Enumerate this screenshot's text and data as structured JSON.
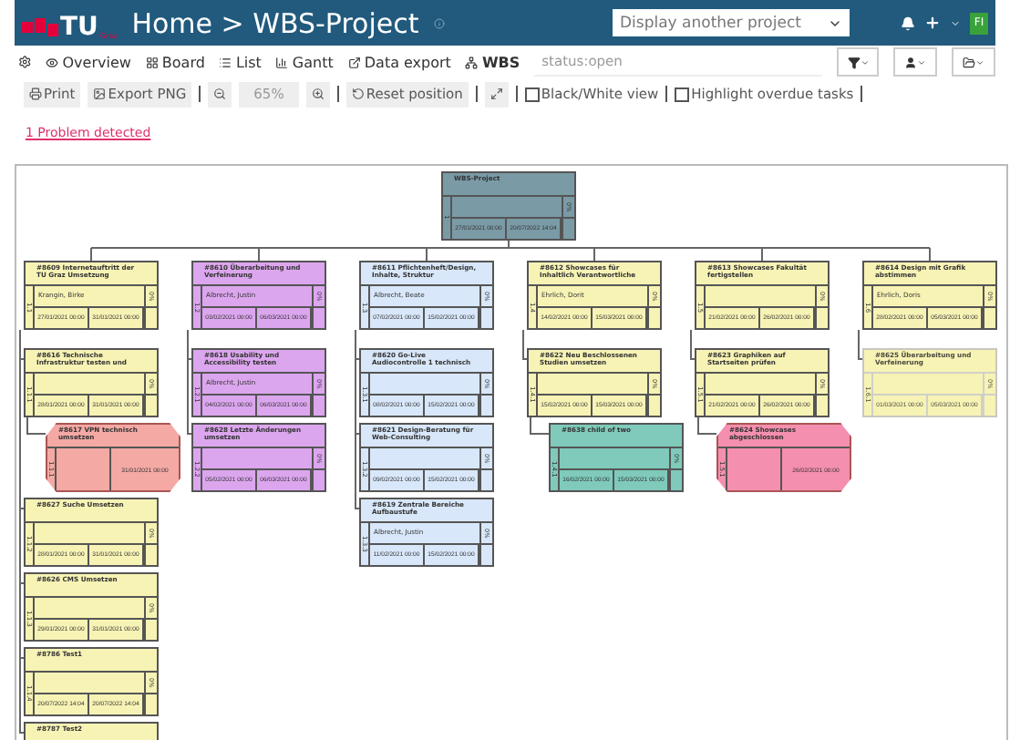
{
  "header": {
    "logo": "TU",
    "logo_sub": "Graz",
    "breadcrumb": "Home > WBS-Project",
    "project_select": {
      "value": "Display another project"
    },
    "avatar": "FI"
  },
  "nav": {
    "items": [
      {
        "label": "Overview",
        "selected": false
      },
      {
        "label": "Board",
        "selected": false
      },
      {
        "label": "List",
        "selected": false
      },
      {
        "label": "Gantt",
        "selected": false
      },
      {
        "label": "Data export",
        "selected": false
      },
      {
        "label": "WBS",
        "selected": true
      }
    ],
    "search": {
      "value": "status:open"
    }
  },
  "toolbar": {
    "print": "Print",
    "export": "Export PNG",
    "zoom": "65%",
    "reset": "Reset position",
    "checkboxes": [
      {
        "label": "Black/White view",
        "checked": false
      },
      {
        "label": "Highlight overdue tasks",
        "checked": false
      }
    ]
  },
  "problem_link": "1 Problem detected",
  "wbs": {
    "title": "WBS-Project",
    "kind": "task",
    "color": "#7a9aa6",
    "faded": false,
    "wbs": "1",
    "start": "27/01/2021 00:00",
    "end": "20/07/2022 14:04",
    "progress": "0%",
    "children": [
      {
        "title": "#8609 Internetauftritt der TU Graz Umsetzung",
        "kind": "task",
        "color": "#f7f3b5",
        "faded": false,
        "wbs": "1.1",
        "assignee": "Krangin, Birke",
        "start": "27/01/2021 00:00",
        "end": "31/01/2021 00:00",
        "progress": "0%",
        "children": [
          {
            "title": "#8616 Technische Infrastruktur testen und",
            "kind": "task",
            "color": "#f7f3b5",
            "faded": false,
            "wbs": "1.1.1",
            "start": "28/01/2021 00:00",
            "end": "31/01/2021 00:00",
            "progress": "0%",
            "children": [
              {
                "title": "#8617 VPN technisch umsetzen",
                "kind": "milestone",
                "color": "#f4a9a4",
                "faded": false,
                "wbs": "1.1.1",
                "end": "31/01/2021 00:00"
              }
            ]
          },
          {
            "title": "#8627 Suche Umsetzen",
            "kind": "task",
            "color": "#f7f3b5",
            "faded": false,
            "wbs": "1.1.2",
            "start": "28/01/2021 00:00",
            "end": "31/01/2021 00:00",
            "progress": "0%"
          },
          {
            "title": "#8626 CMS Umsetzen",
            "kind": "task",
            "color": "#f7f3b5",
            "faded": false,
            "wbs": "1.1.3",
            "start": "29/01/2021 00:00",
            "end": "31/01/2021 00:00",
            "progress": "0%"
          },
          {
            "title": "#8786 Test1",
            "kind": "task",
            "color": "#f7f3b5",
            "faded": false,
            "wbs": "1.1.4",
            "start": "20/07/2022 14:04",
            "end": "20/07/2022 14:04",
            "progress": "0%"
          },
          {
            "title": "#8787 Test2",
            "kind": "task",
            "color": "#f7f3b5",
            "faded": false
          }
        ]
      },
      {
        "title": "#8610 Überarbeitung und Verfeinerung",
        "kind": "task",
        "color": "#dca6ee",
        "faded": false,
        "wbs": "1.2",
        "assignee": "Albrecht, Justin",
        "start": "03/02/2021 00:00",
        "end": "06/03/2021 00:00",
        "progress": "0%",
        "children": [
          {
            "title": "#8618 Usability und Accessibility testen",
            "kind": "task",
            "color": "#dca6ee",
            "faded": false,
            "wbs": "1.2.1",
            "assignee": "Albrecht, Justin",
            "start": "04/02/2021 00:00",
            "end": "06/03/2021 00:00",
            "progress": "0%"
          },
          {
            "title": "#8628 Letzte Änderungen umsetzen",
            "kind": "task",
            "color": "#dca6ee",
            "faded": false,
            "wbs": "1.2.2",
            "start": "05/02/2021 00:00",
            "end": "06/03/2021 00:00",
            "progress": "0%"
          }
        ]
      },
      {
        "title": "#8611 Pflichtenheft/Design, Inhalte, Struktur",
        "kind": "task",
        "color": "#d8e7f9",
        "faded": false,
        "wbs": "1.3",
        "assignee": "Albrecht, Beate",
        "start": "07/02/2021 00:00",
        "end": "15/02/2021 00:00",
        "progress": "0%",
        "children": [
          {
            "title": "#8620 Go-Live Audiocontrolle 1 technisch",
            "kind": "task",
            "color": "#d8e7f9",
            "faded": false,
            "wbs": "1.3.1",
            "start": "08/02/2021 00:00",
            "end": "15/02/2021 00:00",
            "progress": "0%"
          },
          {
            "title": "#8621 Design-Beratung für Web-Consulting",
            "kind": "task",
            "color": "#d8e7f9",
            "faded": false,
            "wbs": "1.3.2",
            "start": "09/02/2021 00:00",
            "end": "15/02/2021 00:00",
            "progress": "0%"
          },
          {
            "title": "#8619 Zentrale Bereiche Aufbaustufe",
            "kind": "task",
            "color": "#d8e7f9",
            "faded": false,
            "wbs": "1.3.3",
            "assignee": "Albrecht, Justin",
            "start": "11/02/2021 00:00",
            "end": "15/02/2021 00:00",
            "progress": "0%"
          }
        ]
      },
      {
        "title": "#8612 Showcases für Inhaltlich Verantwortliche",
        "kind": "task",
        "color": "#f7f3b5",
        "faded": false,
        "wbs": "1.4",
        "assignee": "Ehrlich, Dorit",
        "start": "14/02/2021 00:00",
        "end": "15/03/2021 00:00",
        "progress": "0%",
        "children": [
          {
            "title": "#8622 Neu Beschlossenen Studien umsetzen",
            "kind": "task",
            "color": "#f7f3b5",
            "faded": false,
            "wbs": "1.4.1",
            "start": "15/02/2021 00:00",
            "end": "15/03/2021 00:00",
            "progress": "0%",
            "children": [
              {
                "title": "#8638 child of two",
                "kind": "task",
                "color": "#7fcabb",
                "faded": false,
                "wbs": "1.4.1",
                "start": "16/02/2021 00:00",
                "end": "15/03/2021 00:00",
                "progress": "0%"
              }
            ]
          }
        ]
      },
      {
        "title": "#8613 Showcases Fakultät fertigstellen",
        "kind": "task",
        "color": "#f7f3b5",
        "faded": false,
        "wbs": "1.5",
        "start": "21/02/2021 00:00",
        "end": "26/02/2021 00:00",
        "progress": "0%",
        "children": [
          {
            "title": "#8623 Graphiken auf Startseiten prüfen",
            "kind": "task",
            "color": "#f7f3b5",
            "faded": false,
            "wbs": "1.5.1",
            "start": "21/02/2021 00:00",
            "end": "26/02/2021 00:00",
            "progress": "0%",
            "children": [
              {
                "title": "#8624 Showcases abgeschlossen",
                "kind": "milestone",
                "color": "#f48faf",
                "faded": false,
                "wbs": "1.5.1",
                "end": "26/02/2021 00:00"
              }
            ]
          }
        ]
      },
      {
        "title": "#8614 Design mit Grafik abstimmen",
        "kind": "task",
        "color": "#f7f3b5",
        "faded": false,
        "wbs": "1.6",
        "assignee": "Ehrlich, Doris",
        "start": "28/02/2021 00:00",
        "end": "05/03/2021 00:00",
        "progress": "0%",
        "children": [
          {
            "title": "#8625 Überarbeitung und Verfeinerung",
            "kind": "task",
            "color": "#f7f3b5",
            "faded": true,
            "wbs": "1.6.1",
            "start": "01/03/2021 00:00",
            "end": "05/03/2021 00:00",
            "progress": "0%"
          }
        ]
      }
    ]
  }
}
